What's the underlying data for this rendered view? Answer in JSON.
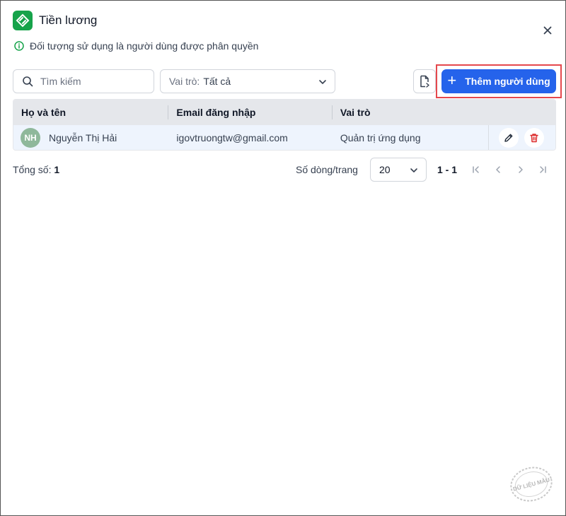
{
  "window": {
    "title": "Tiền lương"
  },
  "notice": {
    "text": "Đối tượng sử dụng là người dùng được phân quyền"
  },
  "toolbar": {
    "search_placeholder": "Tìm kiếm",
    "role_label": "Vai trò:",
    "role_value": "Tất cả",
    "add_label": "Thêm người dùng"
  },
  "table": {
    "headers": [
      "Họ và tên",
      "Email đăng nhập",
      "Vai trò"
    ],
    "rows": [
      {
        "initials": "NH",
        "name": "Nguyễn Thị Hải",
        "email": "igovtruongtw@gmail.com",
        "role": "Quản trị ứng dụng"
      }
    ]
  },
  "footer": {
    "total_label": "Tổng số:",
    "total_value": "1",
    "rows_per_page_label": "Số dòng/trang",
    "rows_per_page_value": "20",
    "range": "1 - 1"
  },
  "watermark": {
    "text": "DỮ LIỆU MẪU"
  },
  "colors": {
    "primary": "#2563eb",
    "logo": "#16a34a",
    "highlight": "#e5484d",
    "delete": "#dc2626",
    "row": "#eef4fd"
  }
}
